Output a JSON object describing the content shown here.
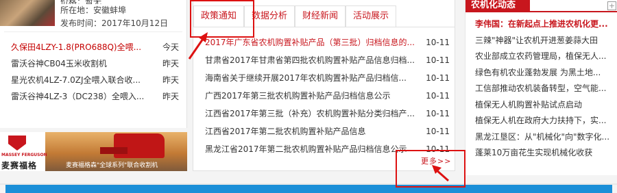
{
  "left": {
    "meta": {
      "clipped_line": "价格：暂无",
      "location": "所在地：安徽蚌埠",
      "publish_time": "发布时间：2017年10月12日"
    },
    "list": [
      {
        "title": "久保田4LZY-1.8(PRO688Q)全喂...",
        "date": "今天",
        "highlight": true
      },
      {
        "title": "雷沃谷神CB04玉米收割机",
        "date": "昨天"
      },
      {
        "title": "星光农机4LZ-7.0ZJ全喂入联合收...",
        "date": "昨天"
      },
      {
        "title": "雷沃谷神4LZ-3（DC238）全喂入...",
        "date": "昨天"
      }
    ],
    "banner": {
      "brand_en": "MASSEY FERGUSON",
      "brand_cn": "麦赛福格森",
      "caption": "麦赛福格森\"全球系列\"联合收割机"
    }
  },
  "tabs": [
    {
      "label": "政策通知",
      "active": true
    },
    {
      "label": "数据分析"
    },
    {
      "label": "财经新闻"
    },
    {
      "label": "活动展示"
    }
  ],
  "news": [
    {
      "title": "2017年广东省农机购置补贴产品（第三批）归档信息的...",
      "date": "10-11",
      "highlight": true
    },
    {
      "title": "甘肃省2017年甘肃省第四批农机购置补贴产品信息归档...",
      "date": "10-11"
    },
    {
      "title": "海南省关于继续开展2017年农机购置补贴产品归档信...",
      "date": "10-11"
    },
    {
      "title": "广西2017年第三批农机购置补贴产品归档信息公示",
      "date": "10-11"
    },
    {
      "title": "江西省2017年第三批（补充）农机购置补贴分类归档产...",
      "date": "10-11"
    },
    {
      "title": "江西省2017年第二批农机购置补贴产品信息",
      "date": "10-11"
    },
    {
      "title": "黑龙江省2017年第二批农机购置补贴产品归档信息公示",
      "date": "10-11"
    }
  ],
  "more_label": "更多>>",
  "right": {
    "title": "农机化动态",
    "more_icon": "+",
    "items": [
      {
        "title": "李伟国：在新起点上推进农机化更...",
        "highlight": true
      },
      {
        "title": "三辣\"神器\"让农机开进葱姜蒜大田"
      },
      {
        "title": "农业部成立农药管理局，植保无人..."
      },
      {
        "title": "绿色有机农业蓬勃发展 为黑土地..."
      },
      {
        "title": "工信部推动农机装备转型，空气能..."
      },
      {
        "title": "植保无人机购置补贴试点启动"
      },
      {
        "title": "植保无人机在政府大力扶持下，实..."
      },
      {
        "title": "黑龙江垦区：从\"机械化\"向\"数字化..."
      },
      {
        "title": "蓬莱10万亩花生实现机械化收获"
      }
    ]
  },
  "colors": {
    "accent": "#c8161d",
    "annotation": "#dd1111",
    "bar": "#1b8fd8"
  }
}
